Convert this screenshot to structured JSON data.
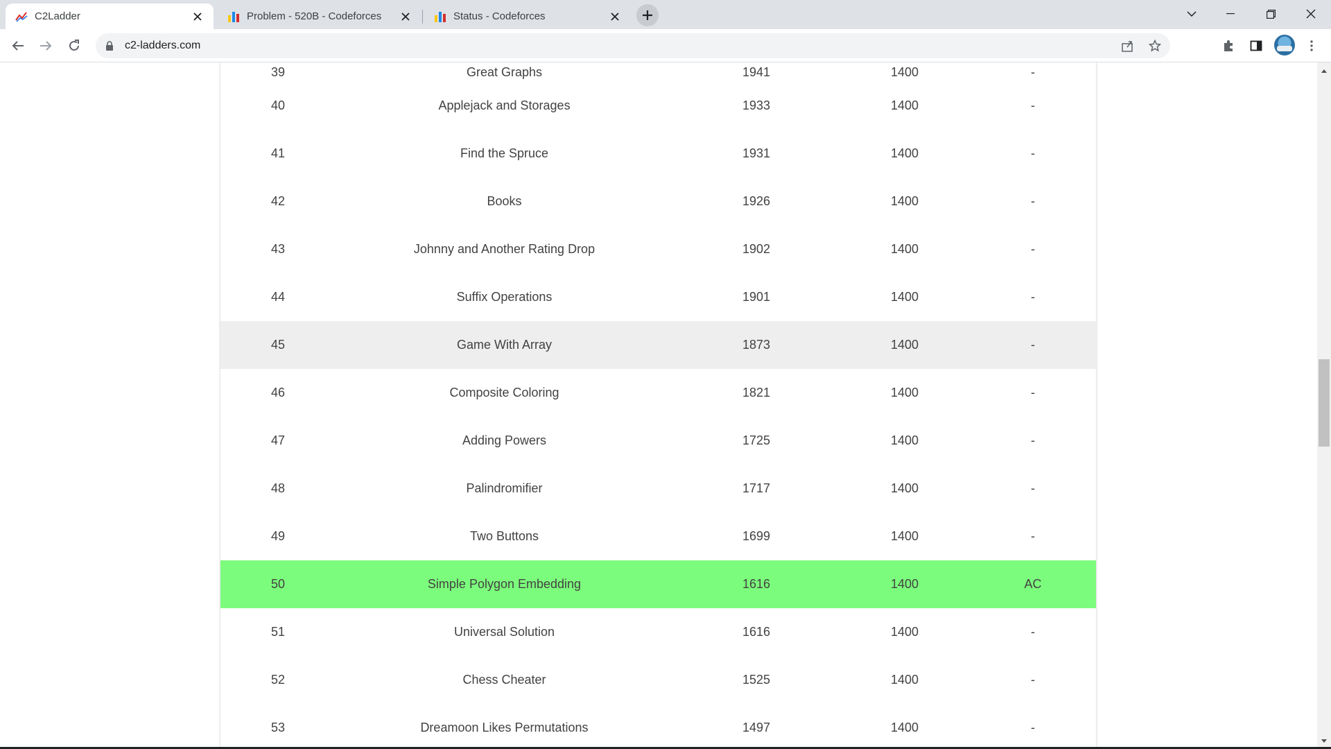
{
  "browser": {
    "tabs": [
      {
        "title": "C2Ladder",
        "favicon": "chart-favicon-icon",
        "active": true
      },
      {
        "title": "Problem - 520B - Codeforces",
        "favicon": "codeforces-favicon-icon",
        "active": false
      },
      {
        "title": "Status - Codeforces",
        "favicon": "codeforces-favicon-icon",
        "active": false
      }
    ],
    "address": "c2-ladders.com",
    "icons": [
      "back-icon",
      "forward-icon",
      "reload-icon",
      "lock-icon",
      "share-icon",
      "star-icon",
      "extensions-icon",
      "side-panel-icon",
      "avatar",
      "menu-icon"
    ]
  },
  "ladder": {
    "rows": [
      {
        "id": "39",
        "name": "Great Graphs",
        "rating": "1941",
        "max": "1400",
        "status": "-"
      },
      {
        "id": "40",
        "name": "Applejack and Storages",
        "rating": "1933",
        "max": "1400",
        "status": "-"
      },
      {
        "id": "41",
        "name": "Find the Spruce",
        "rating": "1931",
        "max": "1400",
        "status": "-"
      },
      {
        "id": "42",
        "name": "Books",
        "rating": "1926",
        "max": "1400",
        "status": "-"
      },
      {
        "id": "43",
        "name": "Johnny and Another Rating Drop",
        "rating": "1902",
        "max": "1400",
        "status": "-"
      },
      {
        "id": "44",
        "name": "Suffix Operations",
        "rating": "1901",
        "max": "1400",
        "status": "-"
      },
      {
        "id": "45",
        "name": "Game With Array",
        "rating": "1873",
        "max": "1400",
        "status": "-"
      },
      {
        "id": "46",
        "name": "Composite Coloring",
        "rating": "1821",
        "max": "1400",
        "status": "-"
      },
      {
        "id": "47",
        "name": "Adding Powers",
        "rating": "1725",
        "max": "1400",
        "status": "-"
      },
      {
        "id": "48",
        "name": "Palindromifier",
        "rating": "1717",
        "max": "1400",
        "status": "-"
      },
      {
        "id": "49",
        "name": "Two Buttons",
        "rating": "1699",
        "max": "1400",
        "status": "-"
      },
      {
        "id": "50",
        "name": "Simple Polygon Embedding",
        "rating": "1616",
        "max": "1400",
        "status": "AC"
      },
      {
        "id": "51",
        "name": "Universal Solution",
        "rating": "1616",
        "max": "1400",
        "status": "-"
      },
      {
        "id": "52",
        "name": "Chess Cheater",
        "rating": "1525",
        "max": "1400",
        "status": "-"
      },
      {
        "id": "53",
        "name": "Dreamoon Likes Permutations",
        "rating": "1497",
        "max": "1400",
        "status": "-"
      }
    ]
  },
  "colors": {
    "solved_row": "#7cfc7c",
    "hover_row": "#eeeeee"
  }
}
